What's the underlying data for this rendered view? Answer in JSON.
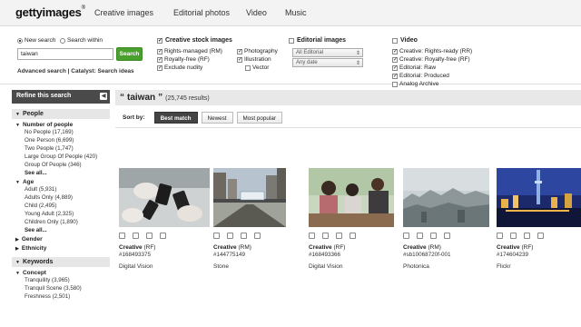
{
  "header": {
    "logo_text": "gettyimages",
    "nav": [
      "Creative images",
      "Editorial photos",
      "Video",
      "Music"
    ]
  },
  "search": {
    "radio_new": "New search",
    "radio_within": "Search within",
    "query": "taiwan",
    "button": "Search",
    "advanced": "Advanced search",
    "separator": "|",
    "catalyst": "Catalyst: Search ideas"
  },
  "creative_filters": {
    "header": "Creative stock images",
    "options": [
      "Rights-managed (RM)",
      "Royalty-free (RF)",
      "Exclude nudity"
    ],
    "options2": [
      "Photography",
      "Illustration",
      "Vector"
    ]
  },
  "editorial_filters": {
    "header": "Editorial images",
    "select1": "All Editorial",
    "select2": "Any date"
  },
  "video_filters": {
    "header": "Video",
    "options": [
      "Creative: Rights-ready (RR)",
      "Creative: Royalty-free (RF)",
      "Editorial: Raw",
      "Editorial: Produced",
      "Analog Archive"
    ]
  },
  "sidebar": {
    "refine": "Refine this search",
    "people_header": "People",
    "number_header": "Number of people",
    "number_items": [
      "No People (17,169)",
      "One Person (6,699)",
      "Two People (1,747)",
      "Large Group Of People (420)",
      "Group Of People (346)"
    ],
    "see_all": "See all...",
    "age_header": "Age",
    "age_items": [
      "Adult (5,931)",
      "Adults Only (4,889)",
      "Child (2,495)",
      "Young Adult (2,325)",
      "Children Only (1,890)"
    ],
    "gender": "Gender",
    "ethnicity": "Ethnicity",
    "keywords_header": "Keywords",
    "concept_header": "Concept",
    "concept_items": [
      "Tranquility (3,965)",
      "Tranquil Scene (3,580)",
      "Freshness (2,501)"
    ]
  },
  "results": {
    "open_quote": "“",
    "query": "taiwan",
    "close_quote": "”",
    "count": "(25,745 results)",
    "sort_label": "Sort by:",
    "sort_options": [
      "Best match",
      "Newest",
      "Most popular"
    ]
  },
  "cards": [
    {
      "type": "Creative",
      "license": "(RF)",
      "id": "#168493375",
      "source": "Digital Vision"
    },
    {
      "type": "Creative",
      "license": "(RM)",
      "id": "#144775149",
      "source": "Stone"
    },
    {
      "type": "Creative",
      "license": "(RF)",
      "id": "#168493366",
      "source": "Digital Vision"
    },
    {
      "type": "Creative",
      "license": "(RM)",
      "id": "#sb10068720f-001",
      "source": "Photonica"
    },
    {
      "type": "Creative",
      "license": "(RF)",
      "id": "#174604239",
      "source": "Flickr"
    }
  ],
  "colors": {
    "search_button": "#4aa02c",
    "refine_bar": "#4a4a4a",
    "sort_active": "#444444"
  }
}
